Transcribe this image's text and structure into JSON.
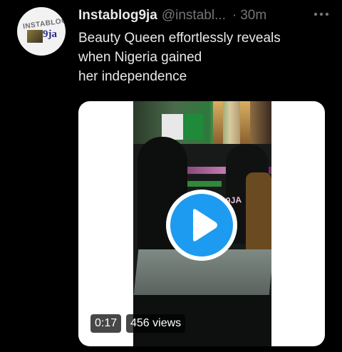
{
  "tweet": {
    "author_name": "Instablog9ja",
    "handle": "@instabl...",
    "separator": "·",
    "time": "30m",
    "more_icon": "more-horizontal-icon",
    "text_lines": [
      "Beauty Queen effortlessly reveals",
      "when Nigeria gained",
      "her independence"
    ],
    "avatar_text_top": "INSTABLOG",
    "avatar_text_bottom": "9ja"
  },
  "media": {
    "duration": "0:17",
    "views": "456 views",
    "watermark": "9JA",
    "play_icon": "play-icon"
  },
  "colors": {
    "background": "#000000",
    "primary_text": "#e7e9ea",
    "secondary_text": "#71767b",
    "accent": "#1d9bf0"
  }
}
